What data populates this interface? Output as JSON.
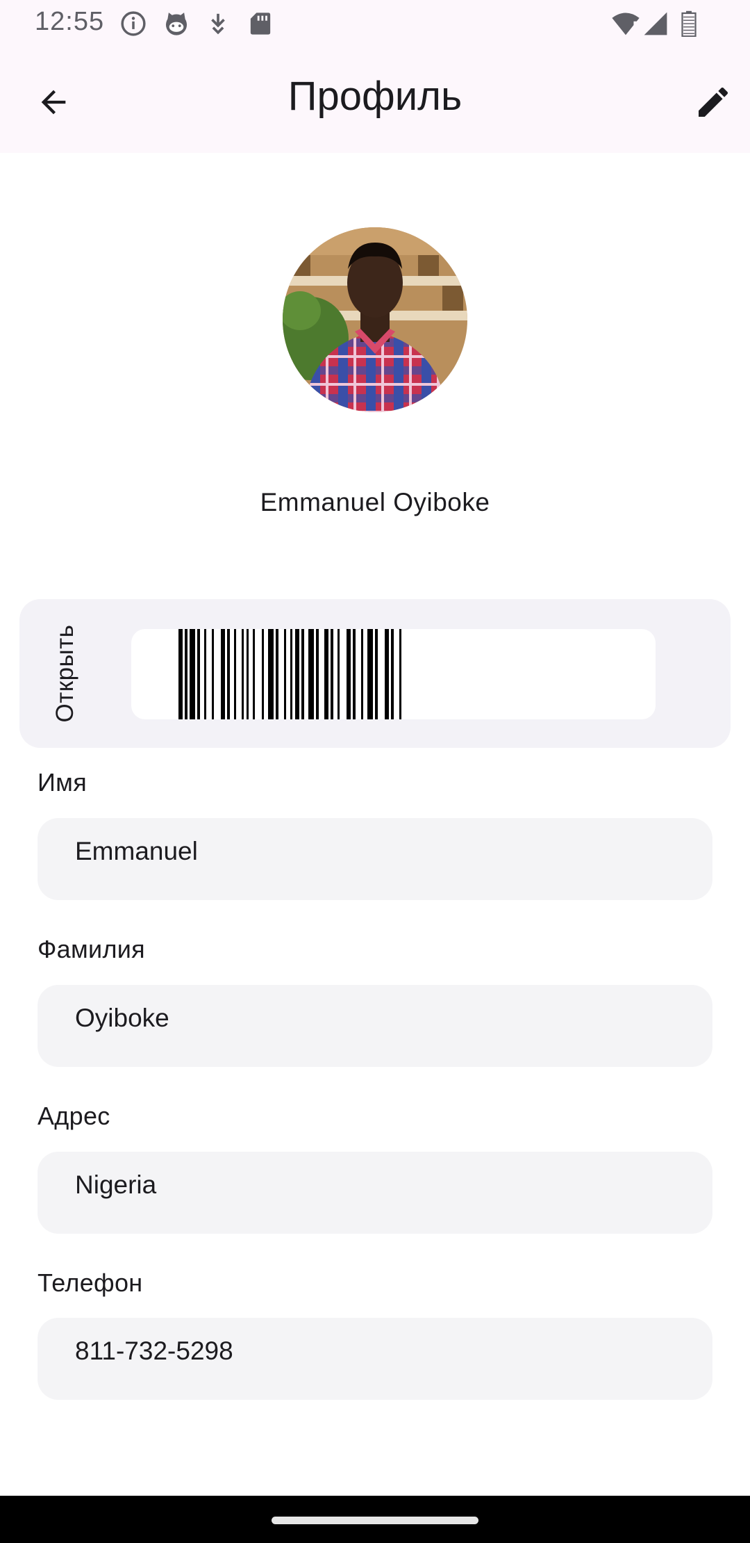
{
  "status_bar": {
    "time": "12:55",
    "icons": [
      "info-icon",
      "cat-face-icon",
      "download-arrow-icon",
      "sd-card-icon",
      "wifi-alert-icon",
      "cell-signal-icon",
      "battery-icon"
    ]
  },
  "app_bar": {
    "title": "Профиль",
    "back_icon": "arrow-back-icon",
    "edit_icon": "pencil-icon"
  },
  "profile": {
    "name": "Emmanuel Oyiboke"
  },
  "barcode_card": {
    "label": "Открыть"
  },
  "fields": {
    "first_name": {
      "label": "Имя",
      "value": "Emmanuel"
    },
    "last_name": {
      "label": "Фамилия",
      "value": "Oyiboke"
    },
    "address": {
      "label": "Адрес",
      "value": "Nigeria"
    },
    "phone": {
      "label": "Телефон",
      "value": "811-732-5298"
    }
  },
  "colors": {
    "top_background": "#fdf7fc",
    "card_background": "#f3f2f7",
    "field_background": "#f4f4f6",
    "text": "#1c1b1f",
    "status_text": "#5f5f66"
  }
}
